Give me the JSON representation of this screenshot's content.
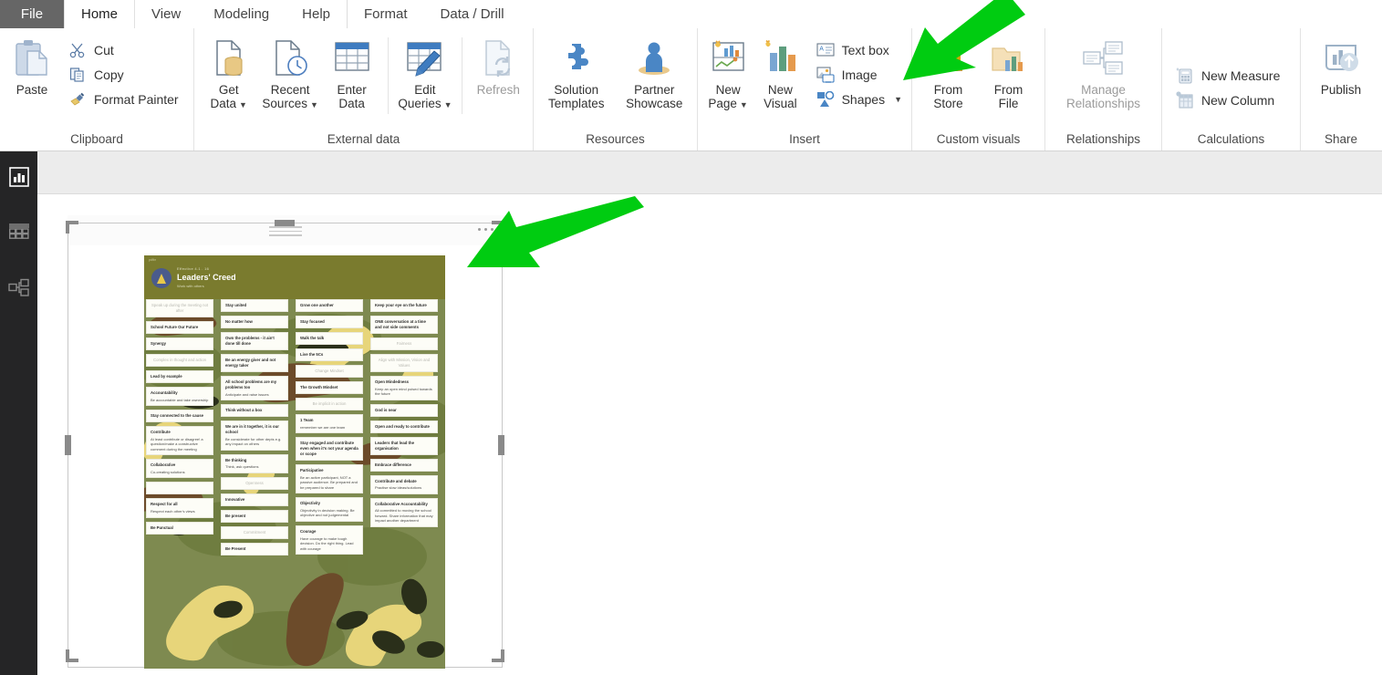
{
  "app": {
    "accent_green": "#00cc11",
    "file_tab_bg": "#666666"
  },
  "tabs": [
    {
      "label": "File",
      "id": "file"
    },
    {
      "label": "Home",
      "id": "home",
      "active": true
    },
    {
      "label": "View",
      "id": "view"
    },
    {
      "label": "Modeling",
      "id": "modeling"
    },
    {
      "label": "Help",
      "id": "help"
    },
    {
      "label": "Format",
      "id": "format"
    },
    {
      "label": "Data / Drill",
      "id": "data-drill"
    }
  ],
  "ribbon": {
    "clipboard": {
      "title": "Clipboard",
      "paste": "Paste",
      "cut": "Cut",
      "copy": "Copy",
      "format_painter": "Format Painter"
    },
    "external_data": {
      "title": "External data",
      "get_data": "Get\nData",
      "get_data_l1": "Get",
      "get_data_l2": "Data",
      "recent_sources_l1": "Recent",
      "recent_sources_l2": "Sources",
      "enter_data_l1": "Enter",
      "enter_data_l2": "Data",
      "edit_queries_l1": "Edit",
      "edit_queries_l2": "Queries",
      "refresh": "Refresh"
    },
    "resources": {
      "title": "Resources",
      "solution_templates_l1": "Solution",
      "solution_templates_l2": "Templates",
      "partner_showcase_l1": "Partner",
      "partner_showcase_l2": "Showcase"
    },
    "insert": {
      "title": "Insert",
      "new_page_l1": "New",
      "new_page_l2": "Page",
      "new_visual_l1": "New",
      "new_visual_l2": "Visual",
      "text_box": "Text box",
      "image": "Image",
      "shapes": "Shapes"
    },
    "custom_visuals": {
      "title": "Custom visuals",
      "from_store_l1": "From",
      "from_store_l2": "Store",
      "from_file_l1": "From",
      "from_file_l2": "File"
    },
    "relationships": {
      "title": "Relationships",
      "manage_l1": "Manage",
      "manage_l2": "Relationships"
    },
    "calculations": {
      "title": "Calculations",
      "new_measure": "New Measure",
      "new_column": "New Column"
    },
    "share": {
      "title": "Share",
      "publish": "Publish"
    }
  },
  "rail": [
    {
      "id": "report",
      "icon": "report-view-icon"
    },
    {
      "id": "data",
      "icon": "data-view-icon"
    },
    {
      "id": "model",
      "icon": "model-view-icon"
    }
  ],
  "visual": {
    "menu_dots": "...",
    "image": {
      "header": {
        "corner_note": "pdfbr",
        "meta": "Effective  4.1 . 16",
        "title": "Leaders' Creed",
        "subtitle": "Work with others"
      },
      "columns": [
        [
          {
            "h": "Speak up during the meeting not after",
            "d": "",
            "ghost": true
          },
          {
            "h": "School Future Our Future",
            "d": ""
          },
          {
            "h": "Synergy",
            "d": ""
          },
          {
            "h": "Complex in thought and action",
            "d": "",
            "ghost": true
          },
          {
            "h": "Lead by example",
            "d": ""
          },
          {
            "h": "Accountability",
            "d": "Be accountable and take ownership"
          },
          {
            "h": "Stay connected to the cause",
            "d": ""
          },
          {
            "h": "Contribute",
            "d": "At least contribute or disagree! a question/make a constructive comment during the meeting"
          },
          {
            "h": "Collaborative",
            "d": "Co-creating solutions"
          },
          {
            "h": "",
            "d": ""
          },
          {
            "h": "Respect for all",
            "d": "Respect each other's views"
          },
          {
            "h": "Be Punctual",
            "d": ""
          }
        ],
        [
          {
            "h": "Stay united",
            "d": ""
          },
          {
            "h": "No matter how",
            "d": ""
          },
          {
            "h": "Own the problems - it ain't done till done",
            "d": ""
          },
          {
            "h": "Be an energy giver and not energy taker",
            "d": ""
          },
          {
            "h": "All school problems are my problems too",
            "d": "Anticipate and raise issues"
          },
          {
            "h": "Think without a box",
            "d": ""
          },
          {
            "h": "We are in it together, it is our school",
            "d": "Be considerate for other depts e.g. any impact on others"
          },
          {
            "h": "Be thinking",
            "d": "Think, ask questions"
          },
          {
            "h": "Openness",
            "d": "",
            "ghost": true
          },
          {
            "h": "Innovative",
            "d": ""
          },
          {
            "h": "Be present",
            "d": ""
          },
          {
            "h": "Commitment",
            "d": "",
            "ghost": true
          },
          {
            "h": "Be Present",
            "d": ""
          }
        ],
        [
          {
            "h": "Grow one another",
            "d": ""
          },
          {
            "h": "Stay focused",
            "d": ""
          },
          {
            "h": "Walk the talk",
            "d": ""
          },
          {
            "h": "Live the 5Cs",
            "d": ""
          },
          {
            "h": "Change Mindset",
            "d": "",
            "ghost": true
          },
          {
            "h": "The Growth Mindset",
            "d": ""
          },
          {
            "h": "Be implicit in action",
            "d": "",
            "ghost": true
          },
          {
            "h": "1 Team",
            "d": "remember we are one team"
          },
          {
            "h": "Stay engaged and contribute even when it's not your agenda or scope",
            "d": ""
          },
          {
            "h": "Participative",
            "d": "Be an active participant, NOT a passive audience. Be prepared and be prepared to share"
          },
          {
            "h": "Objectivity",
            "d": "Objectivity in decision making. Be objective and not judgemental"
          },
          {
            "h": "Courage",
            "d": "Have courage to make tough decision. Do the right thing. Lead with courage"
          }
        ],
        [
          {
            "h": "Keep your eye on the future",
            "d": ""
          },
          {
            "h": "ONE conversation at a time and not side comments",
            "d": ""
          },
          {
            "h": "Fairness",
            "d": "",
            "ghost": true
          },
          {
            "h": "Align with Mission, Vision and Values",
            "d": "",
            "ghost": true
          },
          {
            "h": "Open Mindedness",
            "d": "Keep an open mind poised towards the future"
          },
          {
            "h": "God is near",
            "d": ""
          },
          {
            "h": "Open and ready to contribute",
            "d": ""
          },
          {
            "h": "Leaders that lead the organisation",
            "d": ""
          },
          {
            "h": "Embrace difference",
            "d": ""
          },
          {
            "h": "Contribute and debate",
            "d": "Practise slow ideas/solutions"
          },
          {
            "h": "Collaborative Accountability",
            "d": "All committed to moving the school forward. Share information that may impact another department"
          }
        ]
      ]
    }
  }
}
